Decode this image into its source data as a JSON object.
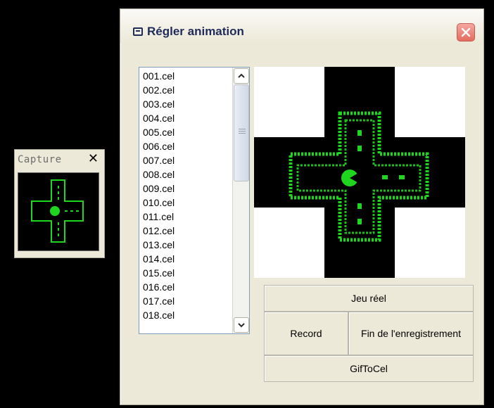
{
  "capture_window": {
    "title": "Capture",
    "close_glyph": "✕"
  },
  "dialog": {
    "title": "Régler animation",
    "close_glyph": "×"
  },
  "file_list": {
    "items": [
      "001.cel",
      "002.cel",
      "003.cel",
      "004.cel",
      "005.cel",
      "006.cel",
      "007.cel",
      "008.cel",
      "009.cel",
      "010.cel",
      "011.cel",
      "012.cel",
      "013.cel",
      "014.cel",
      "015.cel",
      "016.cel",
      "017.cel",
      "018.cel"
    ]
  },
  "buttons": {
    "jeu_reel": "Jeu réel",
    "record": "Record",
    "fin_enregistrement": "Fin de l'enregistrement",
    "gif_to_cel": "GifToCel"
  },
  "colors": {
    "led_green": "#1fd61f",
    "background": "#000000",
    "window_face": "#ece9d8"
  }
}
